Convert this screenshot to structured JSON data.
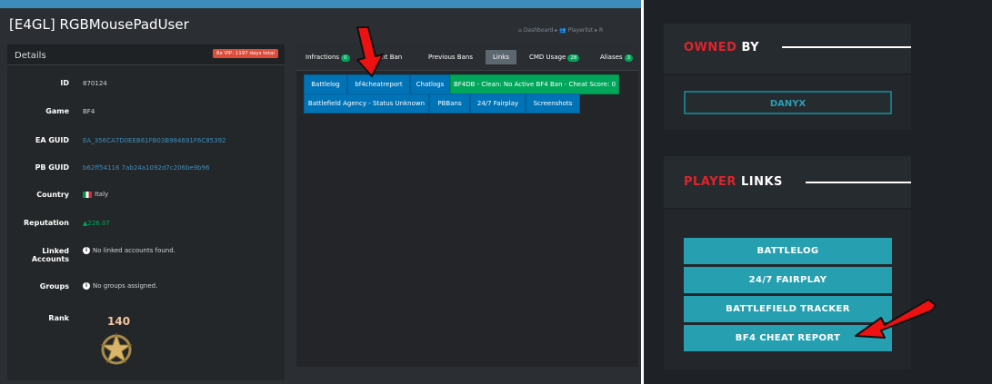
{
  "header": {
    "title": "[E4GL] RGBMousePadUser",
    "breadcrumb": [
      "Dashboard",
      "Playerlist",
      "R"
    ]
  },
  "details": {
    "title": "Details",
    "vip_badge": "8x VIP: 1197 days total",
    "fields": [
      {
        "label": "ID",
        "value": "870124"
      },
      {
        "label": "Game",
        "value": "BF4"
      },
      {
        "label": "EA GUID",
        "value": "EA_356CA7D0EEB61FB03B984691F6C85392"
      },
      {
        "label": "PB GUID",
        "value": "b62ff54116 7ab24a1092d7c206be9b96"
      },
      {
        "label": "Country",
        "value": "Italy"
      },
      {
        "label": "Reputation",
        "value": "▲226.07"
      },
      {
        "label": "Linked Accounts",
        "value": "No linked accounts found."
      },
      {
        "label": "Groups",
        "value": "No groups assigned."
      },
      {
        "label": "Rank",
        "value": "140"
      }
    ]
  },
  "tabs": [
    {
      "label": "Infractions",
      "count": "0"
    },
    {
      "label": "ent Ban",
      "count": ""
    },
    {
      "label": "Previous Bans",
      "count": ""
    },
    {
      "label": "Links",
      "count": ""
    },
    {
      "label": "CMD Usage",
      "count": "28"
    },
    {
      "label": "Aliases",
      "count": "3"
    }
  ],
  "links_row1": [
    "Battlelog",
    "bf4cheatreport",
    "Chatlogs",
    "BF4DB - Clean: No Active BF4 Ban - Cheat Score: 0"
  ],
  "links_row2": [
    "Battlefield Agency - Status Unknown",
    "PBBans",
    "24/7 Fairplay",
    "Screenshots"
  ],
  "right": {
    "owned_by_red": "OWNED",
    "owned_by_white": " BY",
    "owner": "DANYX",
    "player_links_red": "PLAYER",
    "player_links_white": " LINKS",
    "buttons": [
      "BATTLELOG",
      "24/7 FAIRPLAY",
      "BATTLEFIELD TRACKER",
      "BF4 CHEAT REPORT"
    ]
  },
  "colors": {
    "accent_blue": "#0073b7",
    "accent_green": "#00a65a",
    "accent_red": "#e0232b",
    "teal": "#26a0b1"
  }
}
